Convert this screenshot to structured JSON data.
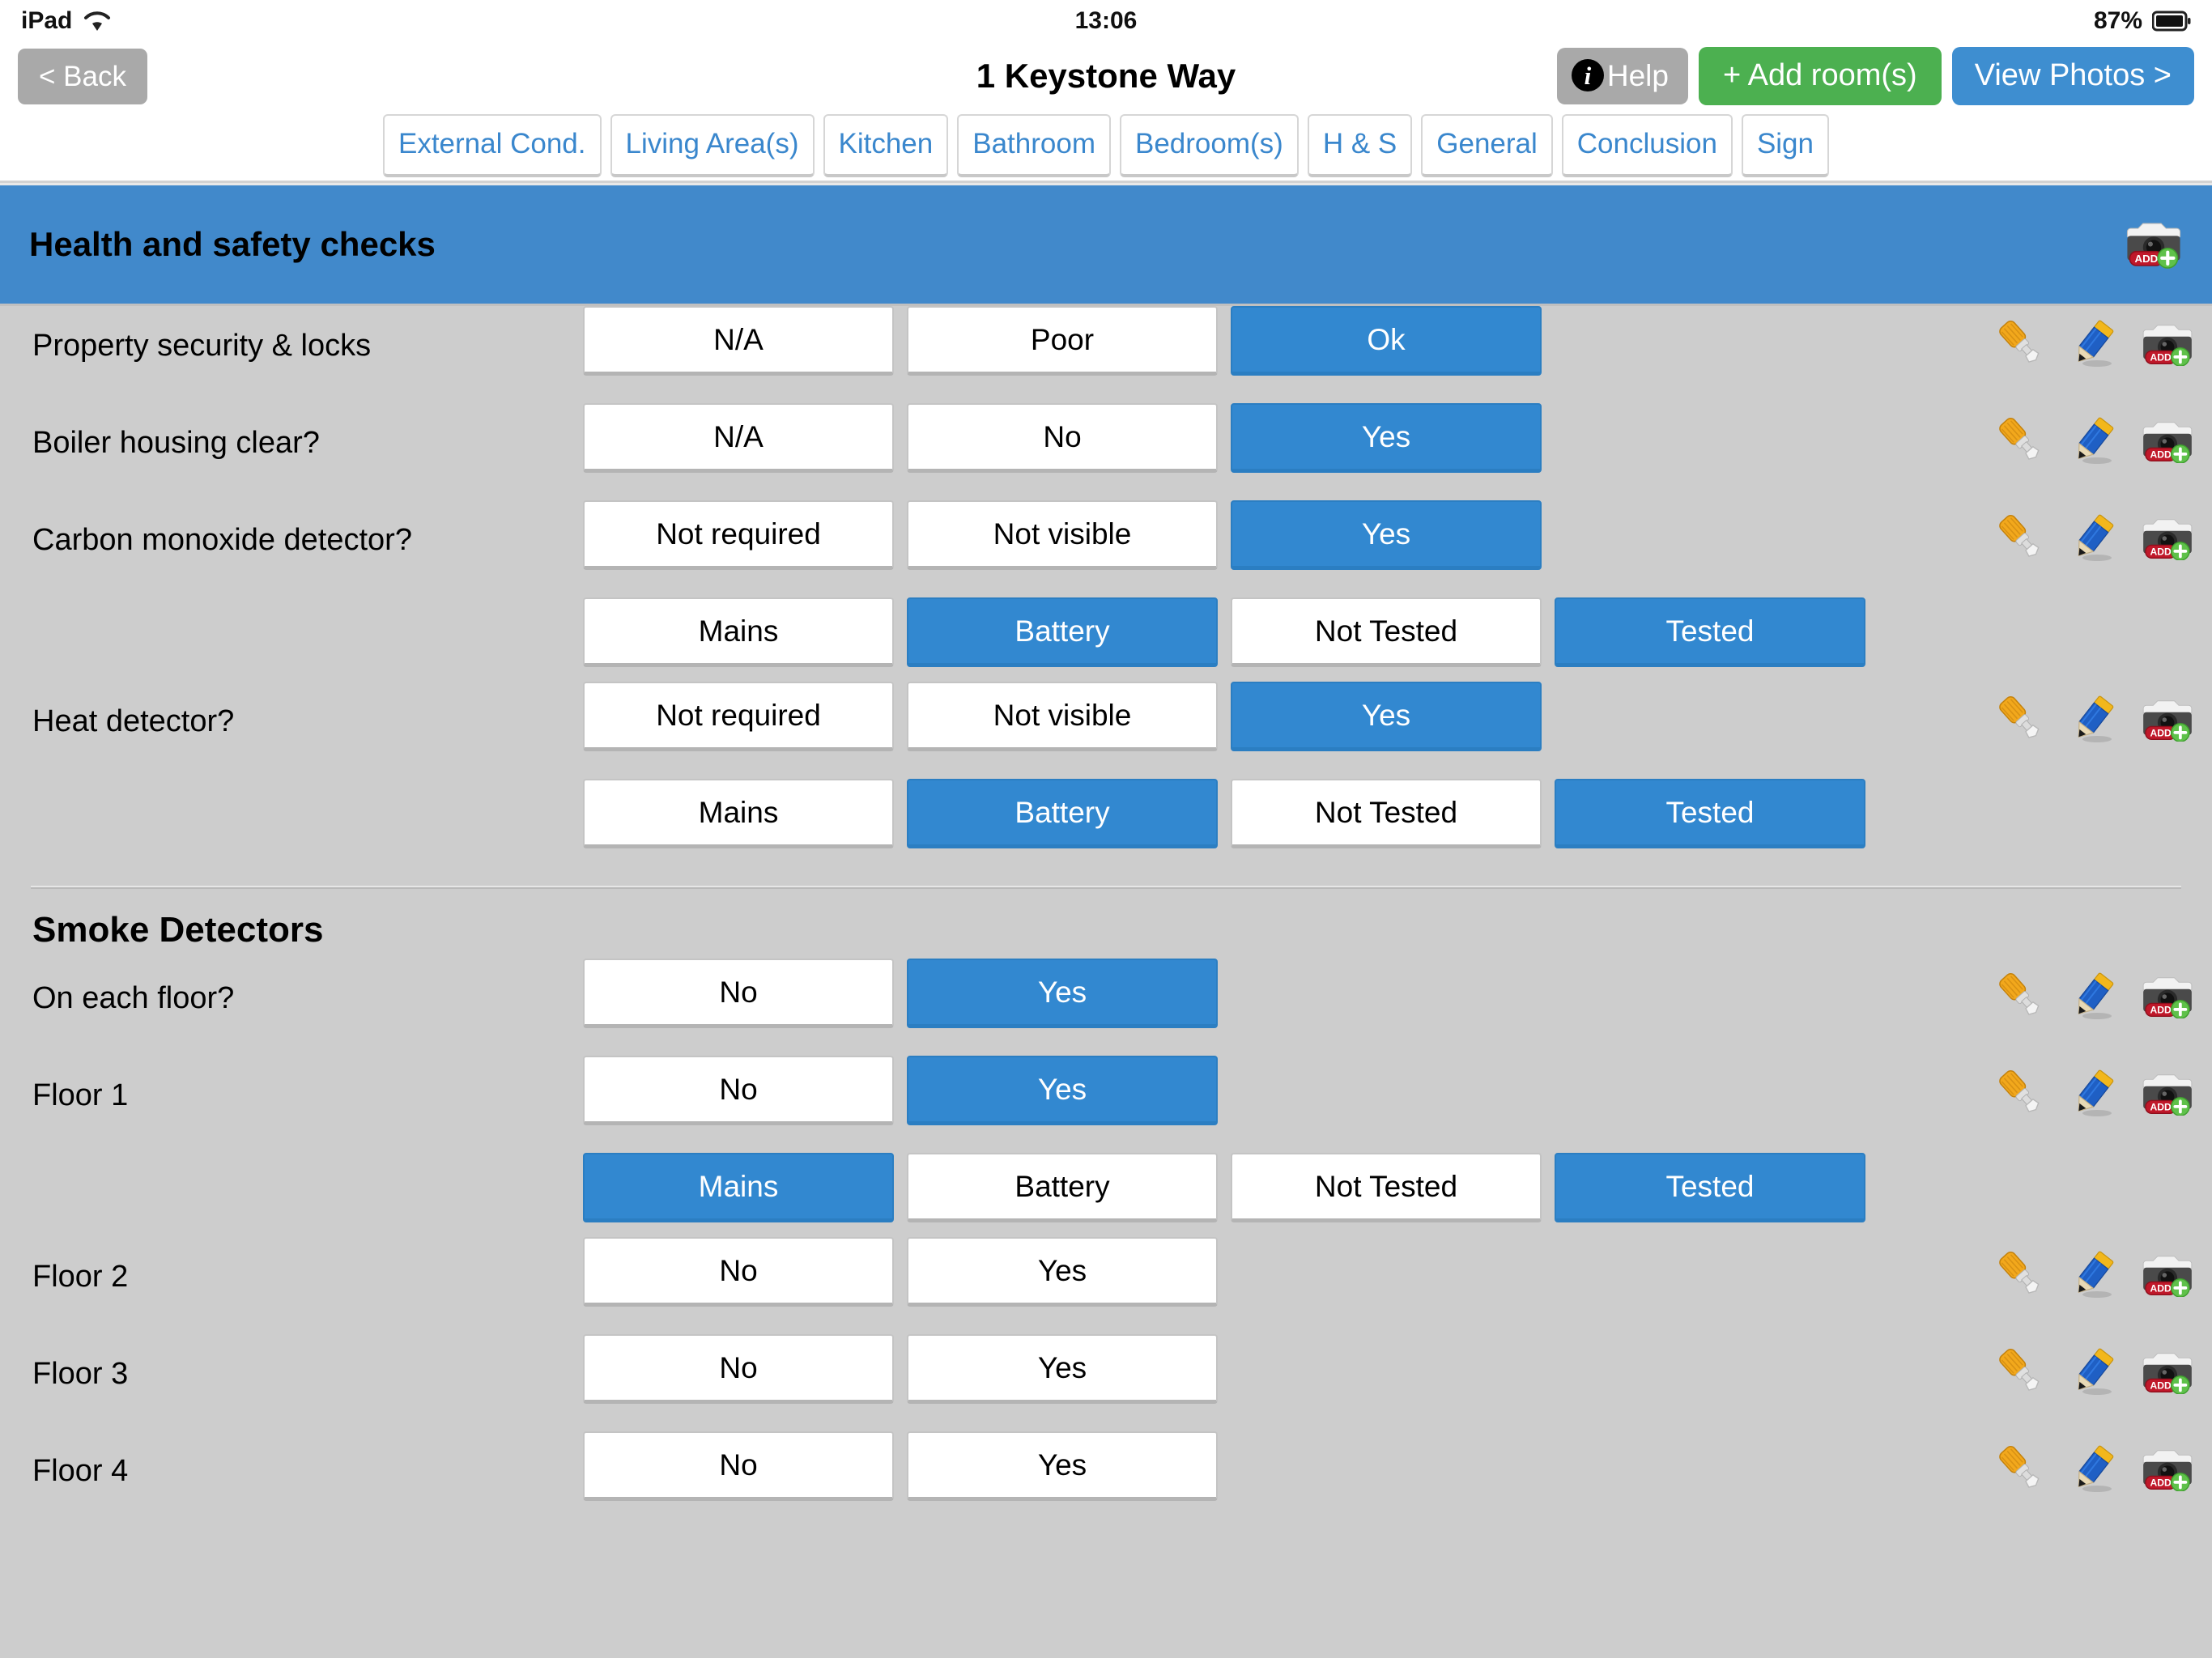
{
  "statusbar": {
    "device": "iPad",
    "wifi_icon": "wifi-icon",
    "time": "13:06",
    "battery_percent": "87%",
    "battery_icon": "battery-icon"
  },
  "toolbar": {
    "back_label": "< Back",
    "title": "1 Keystone Way",
    "help_label": "Help",
    "help_icon": "info-icon",
    "add_rooms_label": "+ Add room(s)",
    "view_photos_label": "View Photos >",
    "colors": {
      "back_bg": "#a9a9a9",
      "help_bg": "#a9a9a9",
      "add_bg": "#4cb050",
      "photos_bg": "#3e8ed0"
    }
  },
  "tabs": [
    {
      "label": "External Cond."
    },
    {
      "label": "Living Area(s)"
    },
    {
      "label": "Kitchen"
    },
    {
      "label": "Bathroom"
    },
    {
      "label": "Bedroom(s)"
    },
    {
      "label": "H & S"
    },
    {
      "label": "General"
    },
    {
      "label": "Conclusion"
    },
    {
      "label": "Sign"
    }
  ],
  "section": {
    "title": "Health and safety checks",
    "bg_color": "#4189cb",
    "camera_icon": "camera-add-icon"
  },
  "row_icons": {
    "screwdriver": "screwdriver-icon",
    "pencil": "pencil-icon",
    "camera": "camera-add-icon"
  },
  "checks": [
    {
      "label": "Property security & locks",
      "options": [
        {
          "text": "N/A",
          "selected": false
        },
        {
          "text": "Poor",
          "selected": false
        },
        {
          "text": "Ok",
          "selected": true
        }
      ],
      "has_icons": true,
      "sub_options": []
    },
    {
      "label": "Boiler housing clear?",
      "options": [
        {
          "text": "N/A",
          "selected": false
        },
        {
          "text": "No",
          "selected": false
        },
        {
          "text": "Yes",
          "selected": true
        }
      ],
      "has_icons": true,
      "sub_options": []
    },
    {
      "label": "Carbon monoxide detector?",
      "options": [
        {
          "text": "Not required",
          "selected": false
        },
        {
          "text": "Not visible",
          "selected": false
        },
        {
          "text": "Yes",
          "selected": true
        }
      ],
      "has_icons": true,
      "sub_options": [
        {
          "text": "Mains",
          "selected": false
        },
        {
          "text": "Battery",
          "selected": true
        },
        {
          "text": "Not Tested",
          "selected": false
        },
        {
          "text": "Tested",
          "selected": true
        }
      ]
    },
    {
      "label": "Heat detector?",
      "options": [
        {
          "text": "Not required",
          "selected": false
        },
        {
          "text": "Not visible",
          "selected": false
        },
        {
          "text": "Yes",
          "selected": true
        }
      ],
      "has_icons": true,
      "sub_options": [
        {
          "text": "Mains",
          "selected": false
        },
        {
          "text": "Battery",
          "selected": true
        },
        {
          "text": "Not Tested",
          "selected": false
        },
        {
          "text": "Tested",
          "selected": true
        }
      ]
    }
  ],
  "smoke_detectors": {
    "title": "Smoke Detectors",
    "rows": [
      {
        "label": "On each floor?",
        "options": [
          {
            "text": "No",
            "selected": false
          },
          {
            "text": "Yes",
            "selected": true
          }
        ],
        "has_icons": true,
        "sub_options": []
      },
      {
        "label": "Floor 1",
        "options": [
          {
            "text": "No",
            "selected": false
          },
          {
            "text": "Yes",
            "selected": true
          }
        ],
        "has_icons": true,
        "sub_options": [
          {
            "text": "Mains",
            "selected": true
          },
          {
            "text": "Battery",
            "selected": false
          },
          {
            "text": "Not Tested",
            "selected": false
          },
          {
            "text": "Tested",
            "selected": true
          }
        ]
      },
      {
        "label": "Floor 2",
        "options": [
          {
            "text": "No",
            "selected": false
          },
          {
            "text": "Yes",
            "selected": false
          }
        ],
        "has_icons": true,
        "sub_options": []
      },
      {
        "label": "Floor 3",
        "options": [
          {
            "text": "No",
            "selected": false
          },
          {
            "text": "Yes",
            "selected": false
          }
        ],
        "has_icons": true,
        "sub_options": []
      },
      {
        "label": "Floor 4",
        "options": [
          {
            "text": "No",
            "selected": false
          },
          {
            "text": "Yes",
            "selected": false
          }
        ],
        "has_icons": true,
        "sub_options": []
      }
    ]
  }
}
